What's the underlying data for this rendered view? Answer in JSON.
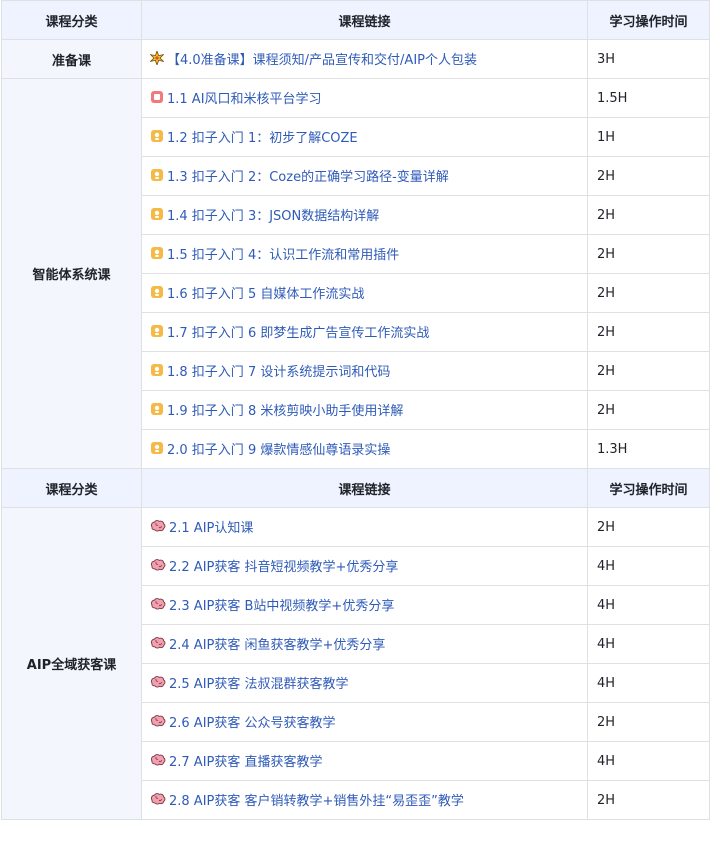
{
  "header1": {
    "category": "课程分类",
    "link": "课程链接",
    "time": "学习操作时间"
  },
  "header2": {
    "category": "课程分类",
    "link": "课程链接",
    "time": "学习操作时间"
  },
  "sections": {
    "prep": {
      "category": "准备课",
      "rows": [
        {
          "icon": "sparkle-icon",
          "label": "【4.0准备课】课程须知/产品宣传和交付/AIP个人包装",
          "time": "3H"
        }
      ]
    },
    "agent": {
      "category": "智能体系统课",
      "rows": [
        {
          "icon": "red-badge-icon",
          "label": "1.1 AI风口和米核平台学习",
          "time": "1.5H"
        },
        {
          "icon": "yellow-badge-icon",
          "label": "1.2  扣子入门 1：初步了解COZE",
          "time": "1H"
        },
        {
          "icon": "yellow-badge-icon",
          "label": "1.3 扣子入门 2：Coze的正确学习路径-变量详解",
          "time": "2H"
        },
        {
          "icon": "yellow-badge-icon",
          "label": "1.4 扣子入门 3：JSON数据结构详解",
          "time": "2H"
        },
        {
          "icon": "yellow-badge-icon",
          "label": "1.5 扣子入门 4：认识工作流和常用插件",
          "time": "2H"
        },
        {
          "icon": "yellow-badge-icon",
          "label": "1.6 扣子入门 5  自媒体工作流实战",
          "time": "2H"
        },
        {
          "icon": "yellow-badge-icon",
          "label": "1.7 扣子入门 6 即梦生成广告宣传工作流实战",
          "time": "2H"
        },
        {
          "icon": "yellow-badge-icon",
          "label": "1.8 扣子入门 7  设计系统提示词和代码",
          "time": "2H"
        },
        {
          "icon": "yellow-badge-icon",
          "label": "1.9 扣子入门 8 米核剪映小助手使用详解",
          "time": "2H"
        },
        {
          "icon": "yellow-badge-icon",
          "label": "2.0 扣子入门 9 爆款情感仙尊语录实操",
          "time": "1.3H"
        }
      ]
    },
    "aip": {
      "category": "AIP全域获客课",
      "rows": [
        {
          "icon": "brain-icon",
          "label": "2.1 AIP认知课",
          "time": "2H"
        },
        {
          "icon": "brain-icon",
          "label": "2.2 AIP获客 抖音短视频教学+优秀分享",
          "time": "4H"
        },
        {
          "icon": "brain-icon",
          "label": "2.3 AIP获客 B站中视频教学+优秀分享",
          "time": "4H"
        },
        {
          "icon": "brain-icon",
          "label": "2.4 AIP获客 闲鱼获客教学+优秀分享",
          "time": "4H"
        },
        {
          "icon": "brain-icon",
          "label": "2.5 AIP获客 法叔混群获客教学",
          "time": "4H"
        },
        {
          "icon": "brain-icon",
          "label": "2.6 AIP获客 公众号获客教学",
          "time": "2H"
        },
        {
          "icon": "brain-icon",
          "label": "2.7 AIP获客 直播获客教学",
          "time": "4H"
        },
        {
          "icon": "brain-icon",
          "label": "2.8 AIP获客  客户销转教学+销售外挂“易歪歪”教学",
          "time": "2H"
        }
      ]
    }
  },
  "colors": {
    "link": "#2f5bb8",
    "header_bg": "#eef3ff",
    "category_bg": "#f3f6fd",
    "border": "#dee0e3"
  }
}
